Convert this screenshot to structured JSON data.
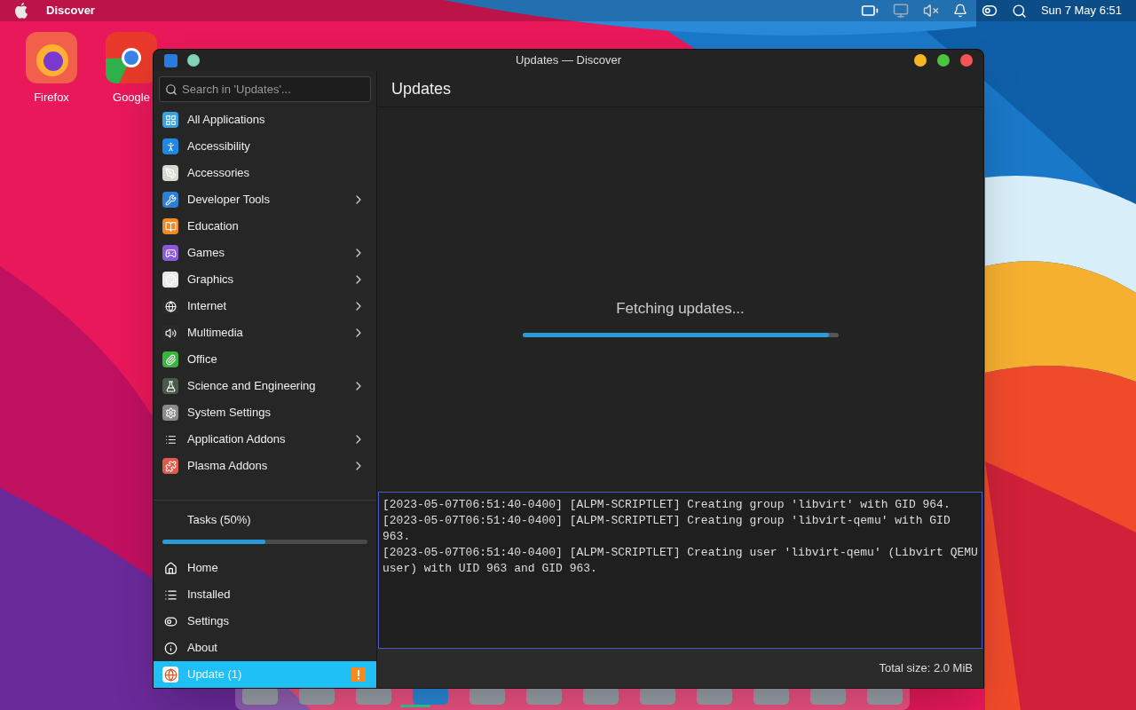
{
  "menu_bar": {
    "app_name": "Discover",
    "clock": "Sun 7 May 6:51"
  },
  "desktop_icons": [
    {
      "label": "Firefox"
    },
    {
      "label": "Google"
    }
  ],
  "window": {
    "title": "Updates — Discover"
  },
  "search": {
    "placeholder": "Search in 'Updates'..."
  },
  "categories": [
    {
      "label": "All Applications",
      "has_children": false
    },
    {
      "label": "Accessibility",
      "has_children": false
    },
    {
      "label": "Accessories",
      "has_children": false
    },
    {
      "label": "Developer Tools",
      "has_children": true
    },
    {
      "label": "Education",
      "has_children": false
    },
    {
      "label": "Games",
      "has_children": true
    },
    {
      "label": "Graphics",
      "has_children": true
    },
    {
      "label": "Internet",
      "has_children": true
    },
    {
      "label": "Multimedia",
      "has_children": true
    },
    {
      "label": "Office",
      "has_children": false
    },
    {
      "label": "Science and Engineering",
      "has_children": true
    },
    {
      "label": "System Settings",
      "has_children": false
    },
    {
      "label": "Application Addons",
      "has_children": true
    },
    {
      "label": "Plasma Addons",
      "has_children": true
    }
  ],
  "tasks": {
    "label": "Tasks (50%)",
    "level": 0.5
  },
  "nav": [
    {
      "label": "Home",
      "selected": false
    },
    {
      "label": "Installed",
      "selected": false
    },
    {
      "label": "Settings",
      "selected": false
    },
    {
      "label": "About",
      "selected": false
    },
    {
      "label": "Update (1)",
      "selected": true
    }
  ],
  "main": {
    "title": "Updates",
    "status": "Fetching updates...",
    "level": 0.97
  },
  "log": [
    "[2023-05-07T06:51:40-0400] [ALPM-SCRIPTLET] Creating group 'libvirt' with GID 964.",
    "[2023-05-07T06:51:40-0400] [ALPM-SCRIPTLET] Creating group 'libvirt-qemu' with GID 963.",
    "[2023-05-07T06:51:40-0400] [ALPM-SCRIPTLET] Creating user 'libvirt-qemu' (Libvirt QEMU user) with UID 963 and GID 963."
  ],
  "footer": {
    "total_size": "Total size: 2.0 MiB"
  }
}
